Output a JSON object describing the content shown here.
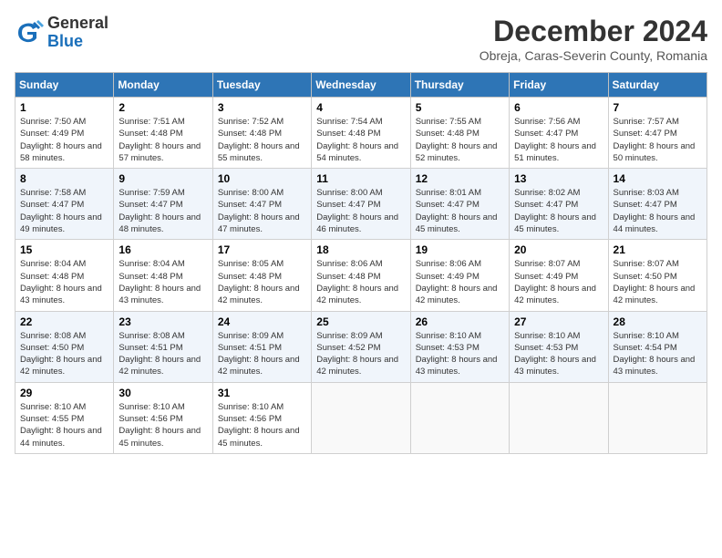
{
  "header": {
    "logo_general": "General",
    "logo_blue": "Blue",
    "month_title": "December 2024",
    "location": "Obreja, Caras-Severin County, Romania"
  },
  "days_of_week": [
    "Sunday",
    "Monday",
    "Tuesday",
    "Wednesday",
    "Thursday",
    "Friday",
    "Saturday"
  ],
  "weeks": [
    [
      {
        "day": "1",
        "sunrise": "7:50 AM",
        "sunset": "4:49 PM",
        "daylight": "8 hours and 58 minutes."
      },
      {
        "day": "2",
        "sunrise": "7:51 AM",
        "sunset": "4:48 PM",
        "daylight": "8 hours and 57 minutes."
      },
      {
        "day": "3",
        "sunrise": "7:52 AM",
        "sunset": "4:48 PM",
        "daylight": "8 hours and 55 minutes."
      },
      {
        "day": "4",
        "sunrise": "7:54 AM",
        "sunset": "4:48 PM",
        "daylight": "8 hours and 54 minutes."
      },
      {
        "day": "5",
        "sunrise": "7:55 AM",
        "sunset": "4:48 PM",
        "daylight": "8 hours and 52 minutes."
      },
      {
        "day": "6",
        "sunrise": "7:56 AM",
        "sunset": "4:47 PM",
        "daylight": "8 hours and 51 minutes."
      },
      {
        "day": "7",
        "sunrise": "7:57 AM",
        "sunset": "4:47 PM",
        "daylight": "8 hours and 50 minutes."
      }
    ],
    [
      {
        "day": "8",
        "sunrise": "7:58 AM",
        "sunset": "4:47 PM",
        "daylight": "8 hours and 49 minutes."
      },
      {
        "day": "9",
        "sunrise": "7:59 AM",
        "sunset": "4:47 PM",
        "daylight": "8 hours and 48 minutes."
      },
      {
        "day": "10",
        "sunrise": "8:00 AM",
        "sunset": "4:47 PM",
        "daylight": "8 hours and 47 minutes."
      },
      {
        "day": "11",
        "sunrise": "8:00 AM",
        "sunset": "4:47 PM",
        "daylight": "8 hours and 46 minutes."
      },
      {
        "day": "12",
        "sunrise": "8:01 AM",
        "sunset": "4:47 PM",
        "daylight": "8 hours and 45 minutes."
      },
      {
        "day": "13",
        "sunrise": "8:02 AM",
        "sunset": "4:47 PM",
        "daylight": "8 hours and 45 minutes."
      },
      {
        "day": "14",
        "sunrise": "8:03 AM",
        "sunset": "4:47 PM",
        "daylight": "8 hours and 44 minutes."
      }
    ],
    [
      {
        "day": "15",
        "sunrise": "8:04 AM",
        "sunset": "4:48 PM",
        "daylight": "8 hours and 43 minutes."
      },
      {
        "day": "16",
        "sunrise": "8:04 AM",
        "sunset": "4:48 PM",
        "daylight": "8 hours and 43 minutes."
      },
      {
        "day": "17",
        "sunrise": "8:05 AM",
        "sunset": "4:48 PM",
        "daylight": "8 hours and 42 minutes."
      },
      {
        "day": "18",
        "sunrise": "8:06 AM",
        "sunset": "4:48 PM",
        "daylight": "8 hours and 42 minutes."
      },
      {
        "day": "19",
        "sunrise": "8:06 AM",
        "sunset": "4:49 PM",
        "daylight": "8 hours and 42 minutes."
      },
      {
        "day": "20",
        "sunrise": "8:07 AM",
        "sunset": "4:49 PM",
        "daylight": "8 hours and 42 minutes."
      },
      {
        "day": "21",
        "sunrise": "8:07 AM",
        "sunset": "4:50 PM",
        "daylight": "8 hours and 42 minutes."
      }
    ],
    [
      {
        "day": "22",
        "sunrise": "8:08 AM",
        "sunset": "4:50 PM",
        "daylight": "8 hours and 42 minutes."
      },
      {
        "day": "23",
        "sunrise": "8:08 AM",
        "sunset": "4:51 PM",
        "daylight": "8 hours and 42 minutes."
      },
      {
        "day": "24",
        "sunrise": "8:09 AM",
        "sunset": "4:51 PM",
        "daylight": "8 hours and 42 minutes."
      },
      {
        "day": "25",
        "sunrise": "8:09 AM",
        "sunset": "4:52 PM",
        "daylight": "8 hours and 42 minutes."
      },
      {
        "day": "26",
        "sunrise": "8:10 AM",
        "sunset": "4:53 PM",
        "daylight": "8 hours and 43 minutes."
      },
      {
        "day": "27",
        "sunrise": "8:10 AM",
        "sunset": "4:53 PM",
        "daylight": "8 hours and 43 minutes."
      },
      {
        "day": "28",
        "sunrise": "8:10 AM",
        "sunset": "4:54 PM",
        "daylight": "8 hours and 43 minutes."
      }
    ],
    [
      {
        "day": "29",
        "sunrise": "8:10 AM",
        "sunset": "4:55 PM",
        "daylight": "8 hours and 44 minutes."
      },
      {
        "day": "30",
        "sunrise": "8:10 AM",
        "sunset": "4:56 PM",
        "daylight": "8 hours and 45 minutes."
      },
      {
        "day": "31",
        "sunrise": "8:10 AM",
        "sunset": "4:56 PM",
        "daylight": "8 hours and 45 minutes."
      },
      null,
      null,
      null,
      null
    ]
  ]
}
